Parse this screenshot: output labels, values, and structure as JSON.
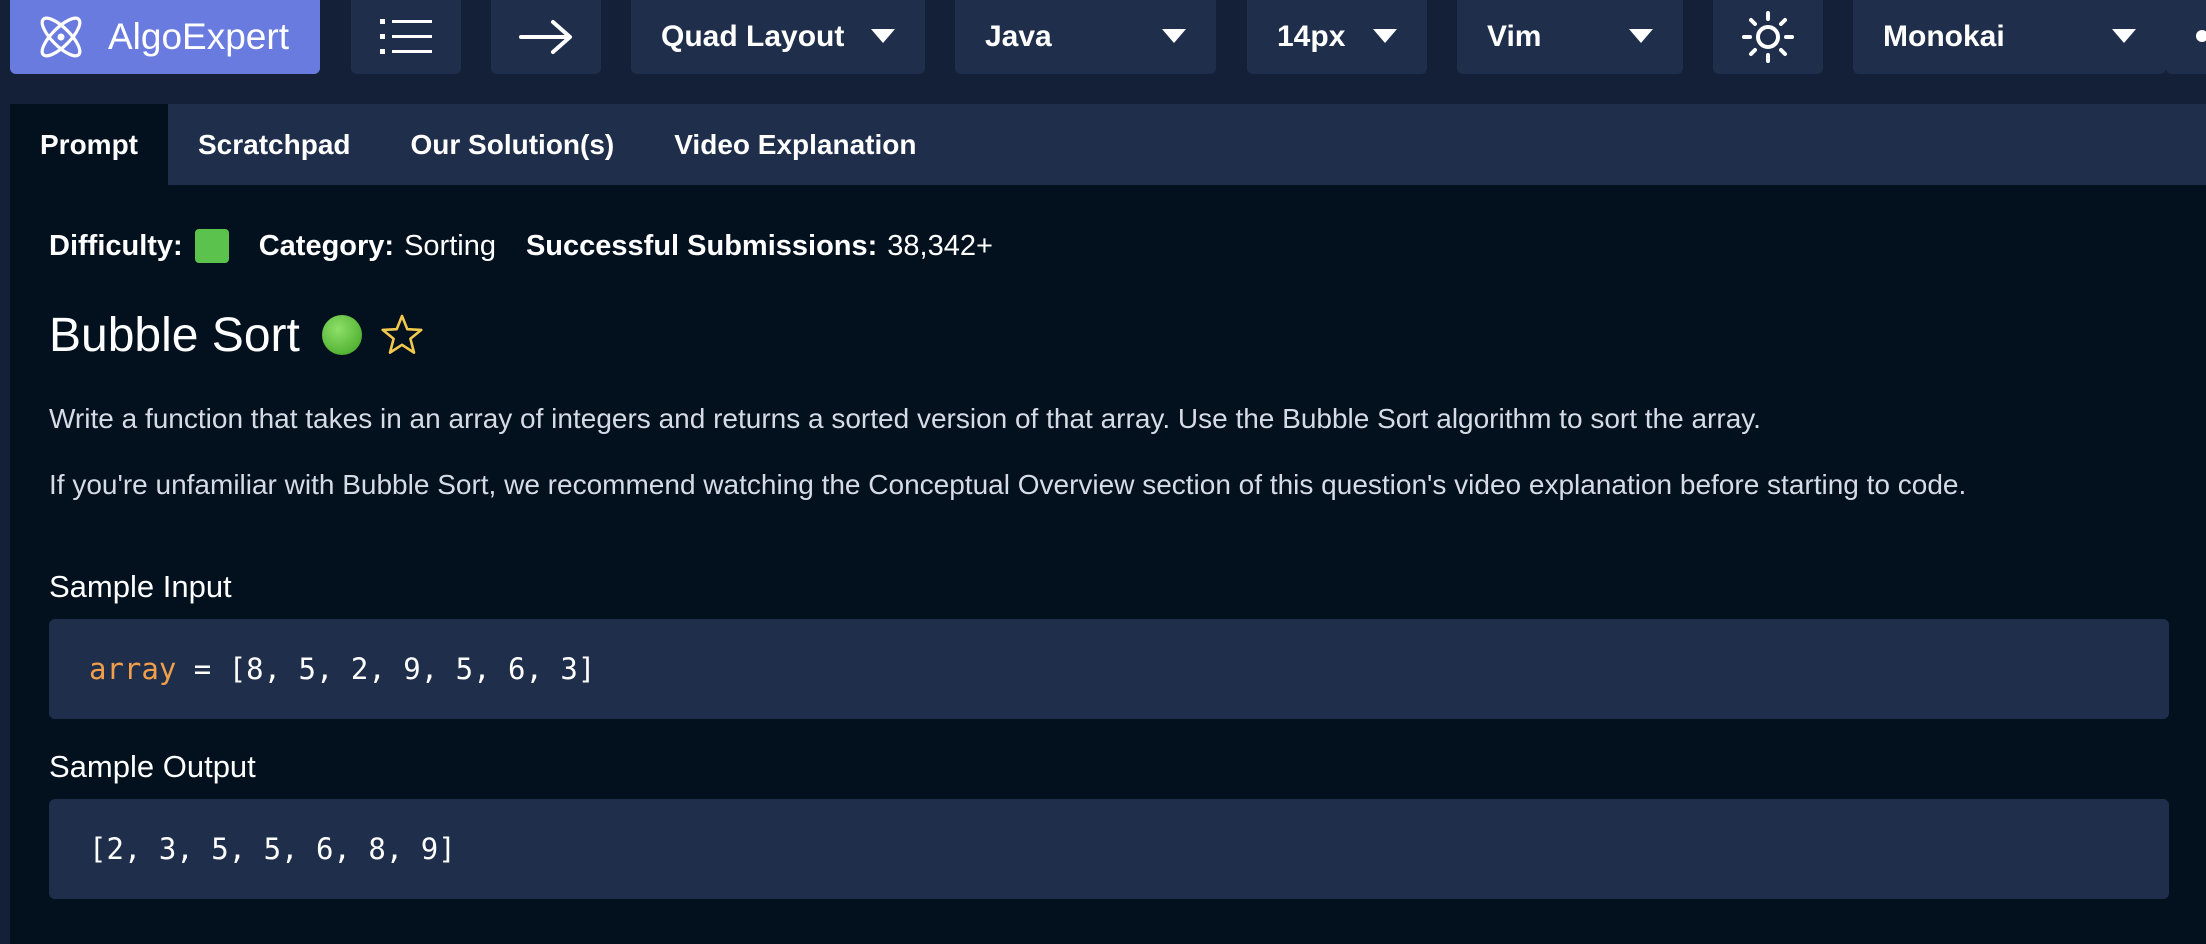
{
  "toolbar": {
    "brand": "AlgoExpert",
    "layout": "Quad Layout",
    "language": "Java",
    "font_size": "14px",
    "keymap": "Vim",
    "theme": "Monokai"
  },
  "tabs": [
    "Prompt",
    "Scratchpad",
    "Our Solution(s)",
    "Video Explanation"
  ],
  "meta": {
    "difficulty_label": "Difficulty:",
    "difficulty_color": "#5bc24e",
    "category_label": "Category:",
    "category_value": "Sorting",
    "submissions_label": "Successful Submissions:",
    "submissions_value": "38,342+"
  },
  "question": {
    "title": "Bubble Sort",
    "description_1": "Write a function that takes in an array of integers and returns a sorted version of that array. Use the Bubble Sort algorithm to sort the array.",
    "description_2": "If you're unfamiliar with Bubble Sort, we recommend watching the Conceptual Overview section of this question's video explanation before starting to code."
  },
  "sample_input": {
    "label": "Sample Input",
    "var": "array",
    "rest": " = [8, 5, 2, 9, 5, 6, 3]"
  },
  "sample_output": {
    "label": "Sample Output",
    "code": "[2, 3, 5, 5, 6, 8, 9]"
  },
  "colors": {
    "accent": "#6a7be0",
    "panel": "#1f2f4b",
    "background": "#03111f",
    "star": "#f2c94c",
    "code_variable": "#f29f4b"
  }
}
